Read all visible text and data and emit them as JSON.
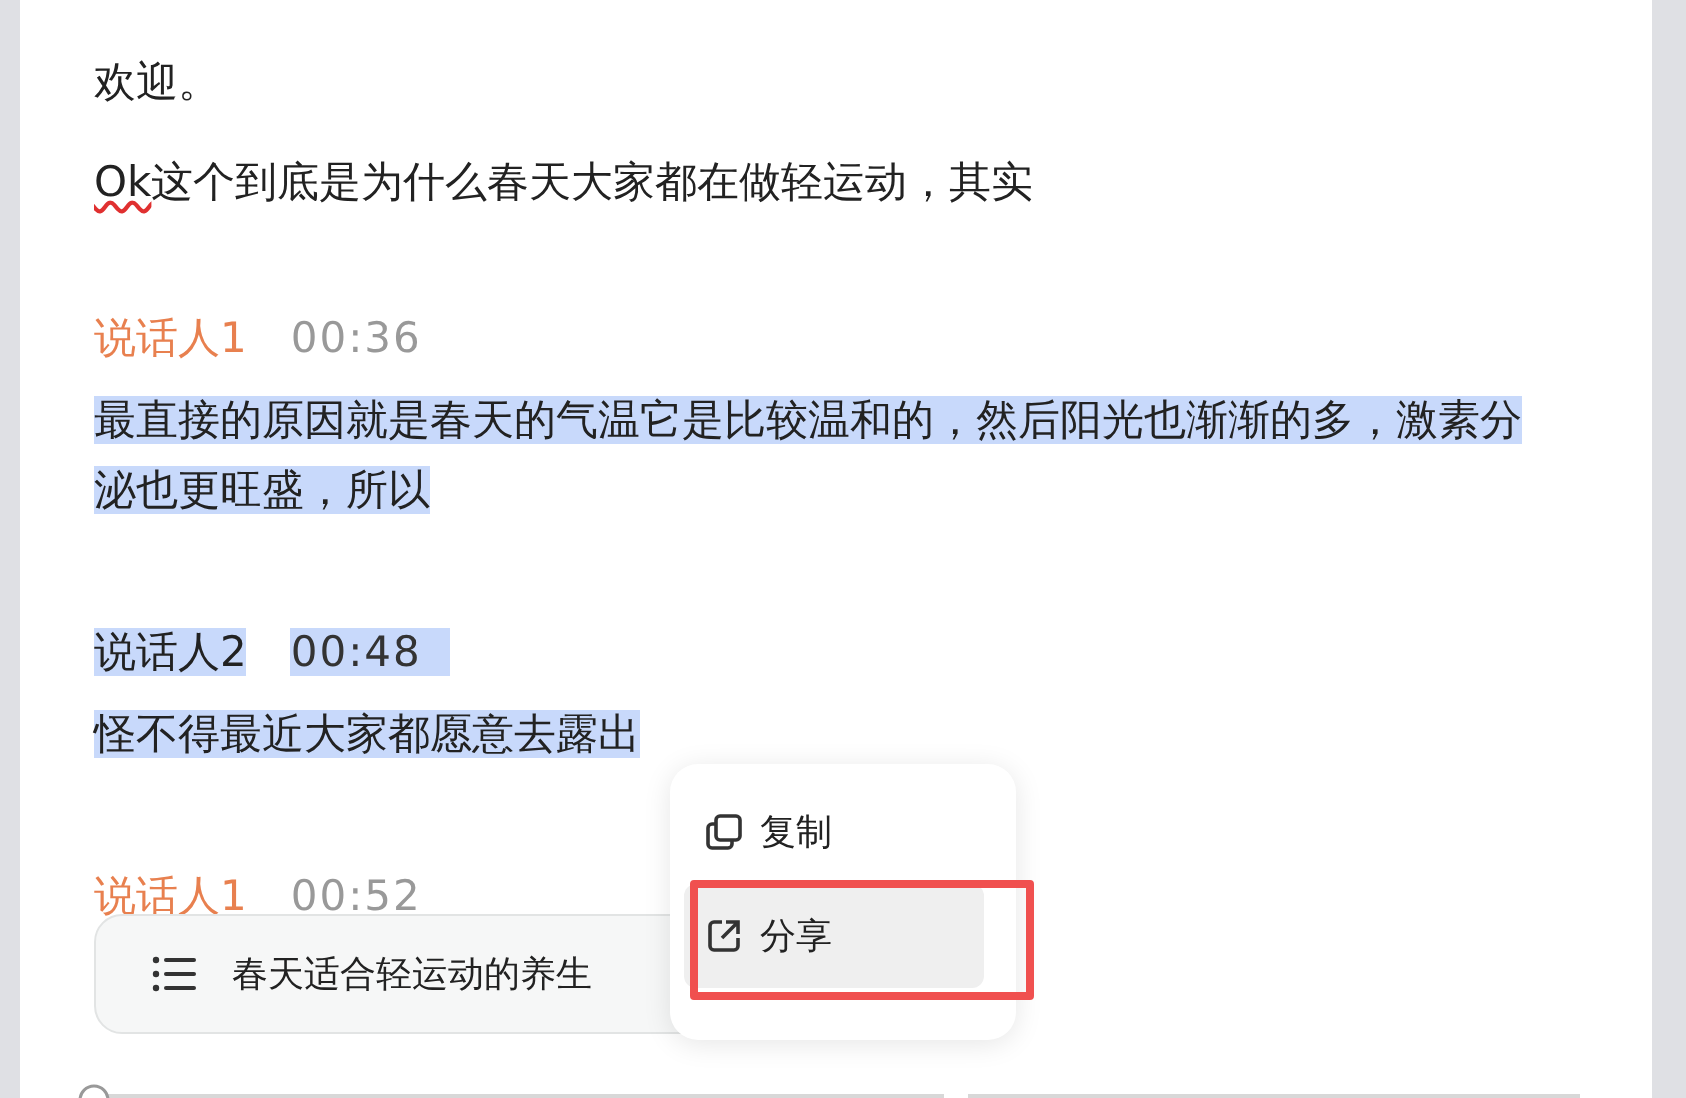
{
  "intro": [
    {
      "parts": [
        {
          "text": "欢迎。",
          "misspelled": false
        }
      ]
    },
    {
      "parts": [
        {
          "text": "Ok",
          "misspelled": true
        },
        {
          "text": "这个到底是为什么春天大家都在做轻运动，其实",
          "misspelled": false
        }
      ]
    }
  ],
  "segments": [
    {
      "speaker": "说话人1",
      "time": "00:36",
      "header_selected": false,
      "lines": [
        {
          "text": "最直接的原因就是春天的气温它是比较温和的，然后阳光也渐渐的多，激素分",
          "selected": true
        },
        {
          "text": "泌也更旺盛，所以",
          "selected": true
        }
      ]
    },
    {
      "speaker": "说话人2",
      "time": "00:48",
      "header_selected": true,
      "lines": [
        {
          "text": "怪不得最近大家都愿意去露出",
          "selected": true
        }
      ]
    },
    {
      "speaker": "说话人1",
      "time": "00:52",
      "header_selected": false
    }
  ],
  "outline_pill": {
    "text": "春天适合轻运动的养生"
  },
  "context_menu": [
    {
      "kind": "copy",
      "label": "复制",
      "selected": false,
      "annotated": false
    },
    {
      "kind": "share",
      "label": "分享",
      "selected": true,
      "annotated": true
    }
  ]
}
